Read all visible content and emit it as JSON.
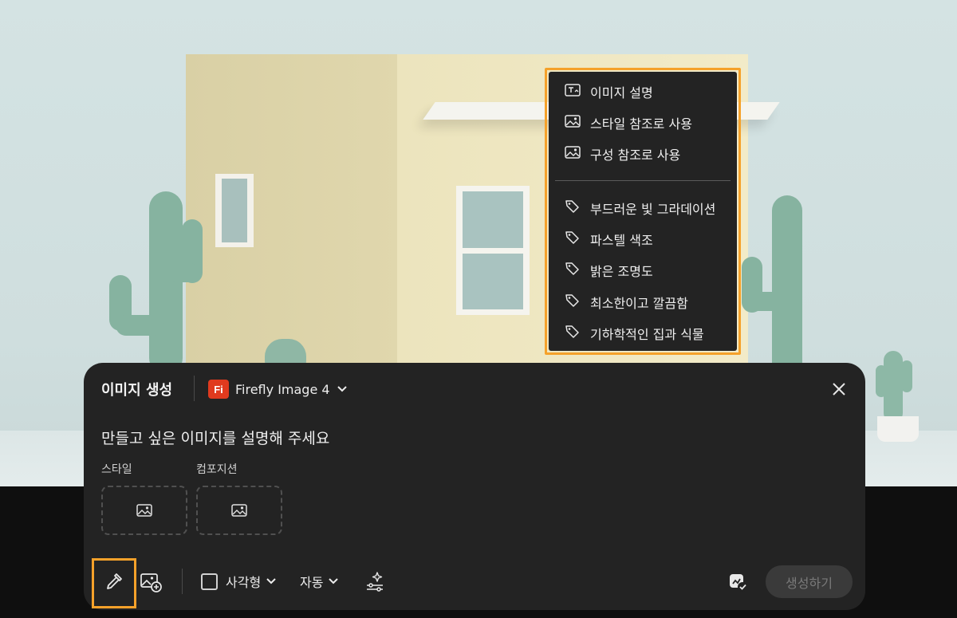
{
  "context_menu": {
    "items": [
      {
        "label": "이미지 설명",
        "icon": "image-text-icon"
      },
      {
        "label": "스타일 참조로 사용",
        "icon": "image-icon"
      },
      {
        "label": "구성 참조로 사용",
        "icon": "image-icon"
      }
    ],
    "tags": [
      {
        "label": "부드러운 빛 그라데이션",
        "icon": "tag-icon"
      },
      {
        "label": "파스텔 색조",
        "icon": "tag-icon"
      },
      {
        "label": "밝은 조명도",
        "icon": "tag-icon"
      },
      {
        "label": "최소한이고 깔끔함",
        "icon": "tag-icon"
      },
      {
        "label": "기하학적인 집과 식물",
        "icon": "tag-icon"
      }
    ]
  },
  "panel": {
    "title": "이미지 생성",
    "model": {
      "logo_text": "Fi",
      "name": "Firefly Image 4",
      "logo_color": "#e03a1e"
    },
    "prompt_placeholder": "만들고 싶은 이미지를 설명해 주세요",
    "style_label": "스타일",
    "composition_label": "컴포지션",
    "toolbar": {
      "aspect_label": "사각형",
      "auto_label": "자동",
      "generate_label": "생성하기"
    }
  },
  "colors": {
    "highlight": "#f5a12a",
    "panel_bg": "#232323",
    "menu_bg": "#232323"
  }
}
